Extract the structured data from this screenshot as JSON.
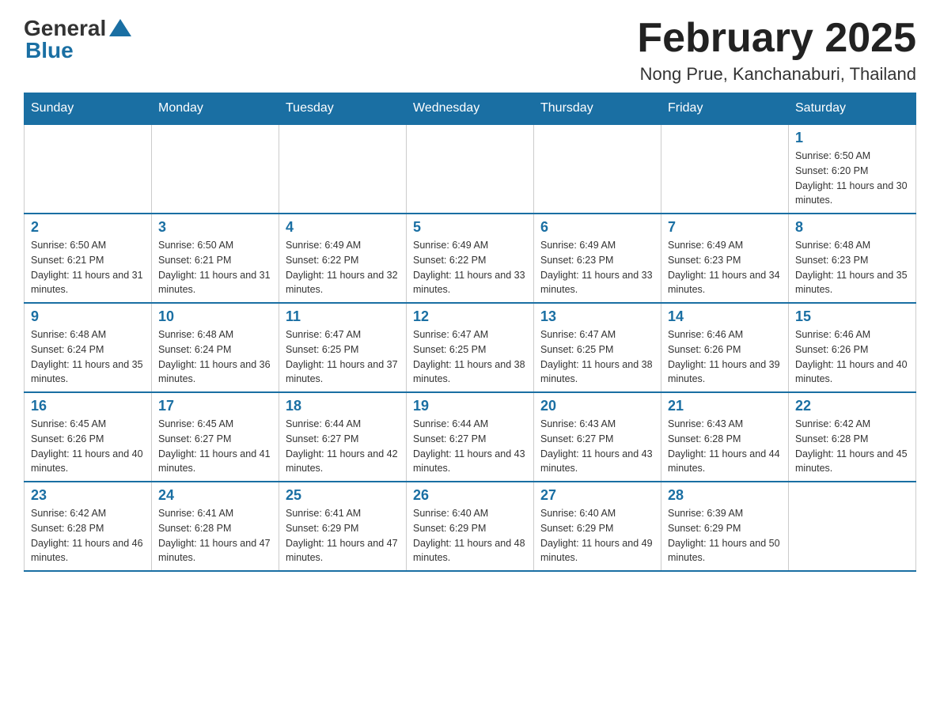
{
  "logo": {
    "general": "General",
    "blue": "Blue"
  },
  "title": "February 2025",
  "location": "Nong Prue, Kanchanaburi, Thailand",
  "weekdays": [
    "Sunday",
    "Monday",
    "Tuesday",
    "Wednesday",
    "Thursday",
    "Friday",
    "Saturday"
  ],
  "weeks": [
    [
      {
        "day": "",
        "info": ""
      },
      {
        "day": "",
        "info": ""
      },
      {
        "day": "",
        "info": ""
      },
      {
        "day": "",
        "info": ""
      },
      {
        "day": "",
        "info": ""
      },
      {
        "day": "",
        "info": ""
      },
      {
        "day": "1",
        "info": "Sunrise: 6:50 AM\nSunset: 6:20 PM\nDaylight: 11 hours and 30 minutes."
      }
    ],
    [
      {
        "day": "2",
        "info": "Sunrise: 6:50 AM\nSunset: 6:21 PM\nDaylight: 11 hours and 31 minutes."
      },
      {
        "day": "3",
        "info": "Sunrise: 6:50 AM\nSunset: 6:21 PM\nDaylight: 11 hours and 31 minutes."
      },
      {
        "day": "4",
        "info": "Sunrise: 6:49 AM\nSunset: 6:22 PM\nDaylight: 11 hours and 32 minutes."
      },
      {
        "day": "5",
        "info": "Sunrise: 6:49 AM\nSunset: 6:22 PM\nDaylight: 11 hours and 33 minutes."
      },
      {
        "day": "6",
        "info": "Sunrise: 6:49 AM\nSunset: 6:23 PM\nDaylight: 11 hours and 33 minutes."
      },
      {
        "day": "7",
        "info": "Sunrise: 6:49 AM\nSunset: 6:23 PM\nDaylight: 11 hours and 34 minutes."
      },
      {
        "day": "8",
        "info": "Sunrise: 6:48 AM\nSunset: 6:23 PM\nDaylight: 11 hours and 35 minutes."
      }
    ],
    [
      {
        "day": "9",
        "info": "Sunrise: 6:48 AM\nSunset: 6:24 PM\nDaylight: 11 hours and 35 minutes."
      },
      {
        "day": "10",
        "info": "Sunrise: 6:48 AM\nSunset: 6:24 PM\nDaylight: 11 hours and 36 minutes."
      },
      {
        "day": "11",
        "info": "Sunrise: 6:47 AM\nSunset: 6:25 PM\nDaylight: 11 hours and 37 minutes."
      },
      {
        "day": "12",
        "info": "Sunrise: 6:47 AM\nSunset: 6:25 PM\nDaylight: 11 hours and 38 minutes."
      },
      {
        "day": "13",
        "info": "Sunrise: 6:47 AM\nSunset: 6:25 PM\nDaylight: 11 hours and 38 minutes."
      },
      {
        "day": "14",
        "info": "Sunrise: 6:46 AM\nSunset: 6:26 PM\nDaylight: 11 hours and 39 minutes."
      },
      {
        "day": "15",
        "info": "Sunrise: 6:46 AM\nSunset: 6:26 PM\nDaylight: 11 hours and 40 minutes."
      }
    ],
    [
      {
        "day": "16",
        "info": "Sunrise: 6:45 AM\nSunset: 6:26 PM\nDaylight: 11 hours and 40 minutes."
      },
      {
        "day": "17",
        "info": "Sunrise: 6:45 AM\nSunset: 6:27 PM\nDaylight: 11 hours and 41 minutes."
      },
      {
        "day": "18",
        "info": "Sunrise: 6:44 AM\nSunset: 6:27 PM\nDaylight: 11 hours and 42 minutes."
      },
      {
        "day": "19",
        "info": "Sunrise: 6:44 AM\nSunset: 6:27 PM\nDaylight: 11 hours and 43 minutes."
      },
      {
        "day": "20",
        "info": "Sunrise: 6:43 AM\nSunset: 6:27 PM\nDaylight: 11 hours and 43 minutes."
      },
      {
        "day": "21",
        "info": "Sunrise: 6:43 AM\nSunset: 6:28 PM\nDaylight: 11 hours and 44 minutes."
      },
      {
        "day": "22",
        "info": "Sunrise: 6:42 AM\nSunset: 6:28 PM\nDaylight: 11 hours and 45 minutes."
      }
    ],
    [
      {
        "day": "23",
        "info": "Sunrise: 6:42 AM\nSunset: 6:28 PM\nDaylight: 11 hours and 46 minutes."
      },
      {
        "day": "24",
        "info": "Sunrise: 6:41 AM\nSunset: 6:28 PM\nDaylight: 11 hours and 47 minutes."
      },
      {
        "day": "25",
        "info": "Sunrise: 6:41 AM\nSunset: 6:29 PM\nDaylight: 11 hours and 47 minutes."
      },
      {
        "day": "26",
        "info": "Sunrise: 6:40 AM\nSunset: 6:29 PM\nDaylight: 11 hours and 48 minutes."
      },
      {
        "day": "27",
        "info": "Sunrise: 6:40 AM\nSunset: 6:29 PM\nDaylight: 11 hours and 49 minutes."
      },
      {
        "day": "28",
        "info": "Sunrise: 6:39 AM\nSunset: 6:29 PM\nDaylight: 11 hours and 50 minutes."
      },
      {
        "day": "",
        "info": ""
      }
    ]
  ]
}
